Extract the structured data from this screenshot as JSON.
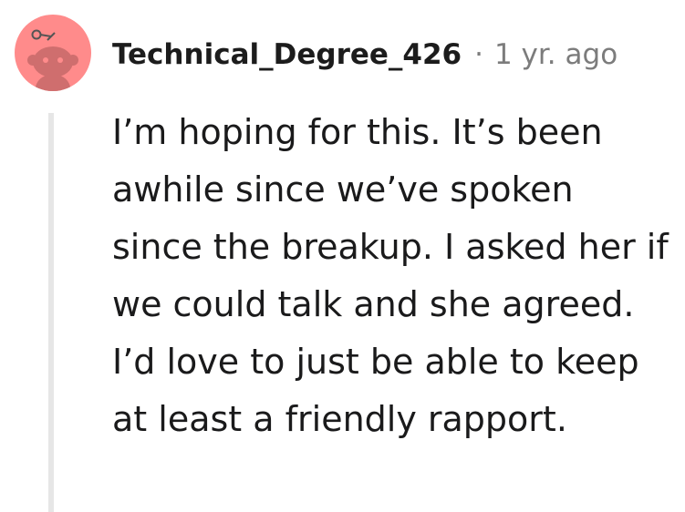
{
  "comment": {
    "author": "Technical_Degree_426",
    "separator": "·",
    "timestamp": "1 yr. ago",
    "body": "I’m hoping for this. It’s been awhile since we’ve spoken since the breakup. I asked her if we could talk and she agreed. I’d love to just be able to keep at least a friendly rapport.",
    "avatar": {
      "icon": "snoo-avatar-icon",
      "background_color": "#ff8b8b"
    }
  }
}
